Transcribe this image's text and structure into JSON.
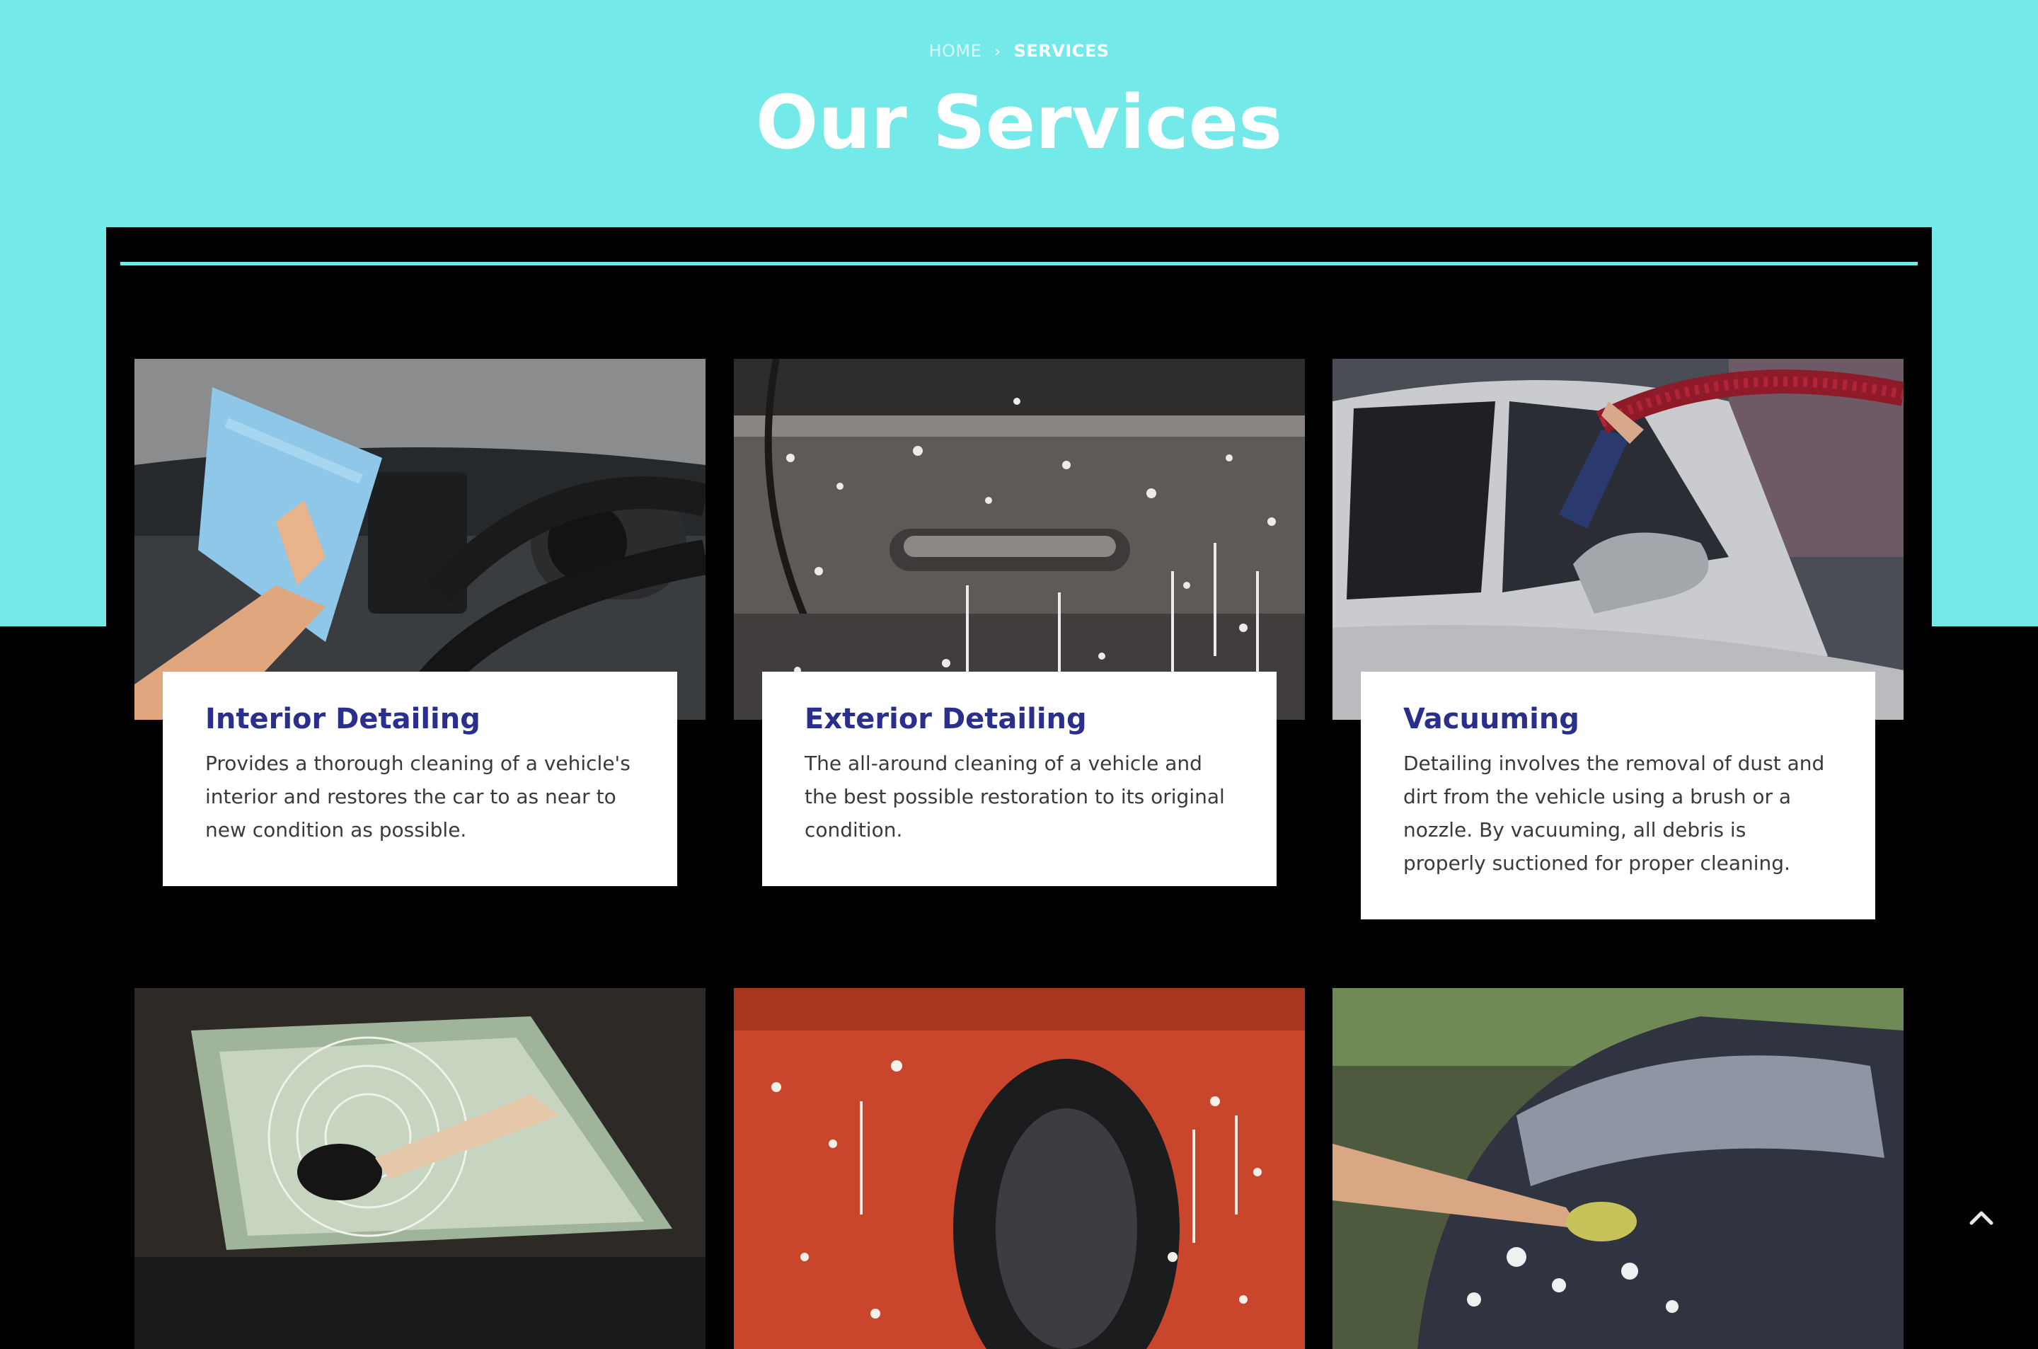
{
  "breadcrumb": {
    "home": "HOME",
    "current": "SERVICES"
  },
  "page_title": "Our Services",
  "colors": {
    "accent": "#74E9EA",
    "title": "#2B2F8C",
    "body_text": "#3a3a3a"
  },
  "services": [
    {
      "title": "Interior Detailing",
      "description": "Provides a thorough cleaning of a vehicle's interior and restores the car to as near to new condition as possible."
    },
    {
      "title": "Exterior Detailing",
      "description": "The all-around cleaning of a vehicle and the best possible restoration to its original condition."
    },
    {
      "title": "Vacuuming",
      "description": "Detailing involves the removal of dust and dirt from the vehicle using a brush or a nozzle. By vacuuming, all debris is properly suctioned for proper cleaning."
    }
  ],
  "scroll_top_icon": "chevron-up-icon"
}
